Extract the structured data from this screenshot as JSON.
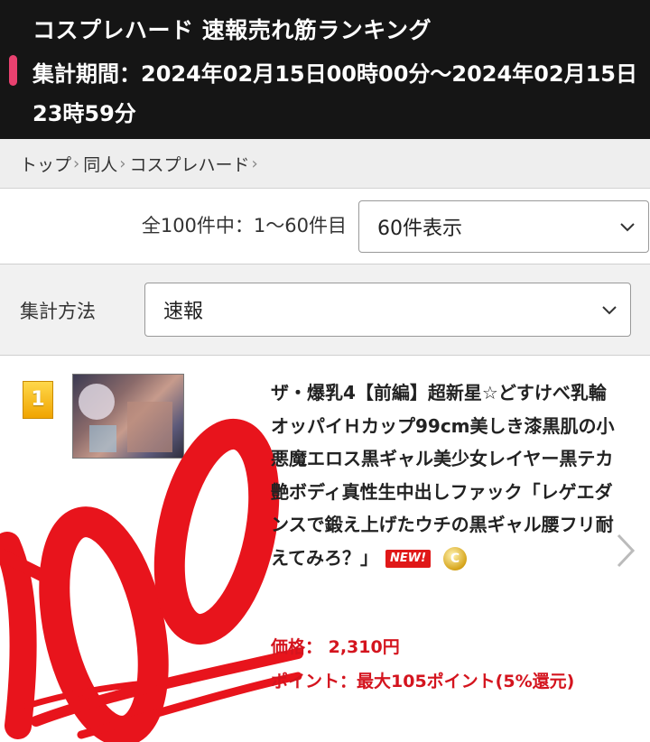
{
  "header": {
    "title": "コスプレハード 速報売れ筋ランキング",
    "period": "集計期間：2024年02月15日00時00分～2024年02月15日23時59分"
  },
  "breadcrumb": [
    {
      "label": "トップ"
    },
    {
      "label": "同人"
    },
    {
      "label": "コスプレハード"
    }
  ],
  "pagination": {
    "count_text": "全100件中：1～60件目",
    "per_page_selected": "60件表示"
  },
  "method": {
    "label": "集計方法",
    "selected": "速報"
  },
  "items": [
    {
      "rank": "1",
      "title": "ザ・爆乳4【前編】超新星☆どすけべ乳輪オッパイＨカップ99cm美しき漆黒肌の小悪魔エロス黒ギャル美少女レイヤー黒テカ艶ボディ真性生中出しファック「レゲエダンスで鍛え上げたウチの黒ギャル腰フリ耐えてみろ？」",
      "new_badge": "NEW!",
      "coin_mark": "C",
      "price": "価格： 2,310円",
      "points": "ポイント：最大105ポイント(5%還元)"
    }
  ],
  "colors": {
    "header_bg": "#151515",
    "accent": "#e8416f",
    "price_red": "#d4141e",
    "graffiti_red": "#e8141c"
  },
  "icons": [
    "chevron-right-icon",
    "chevron-down-icon",
    "rank-badge",
    "coin-icon",
    "next-arrow-icon"
  ]
}
